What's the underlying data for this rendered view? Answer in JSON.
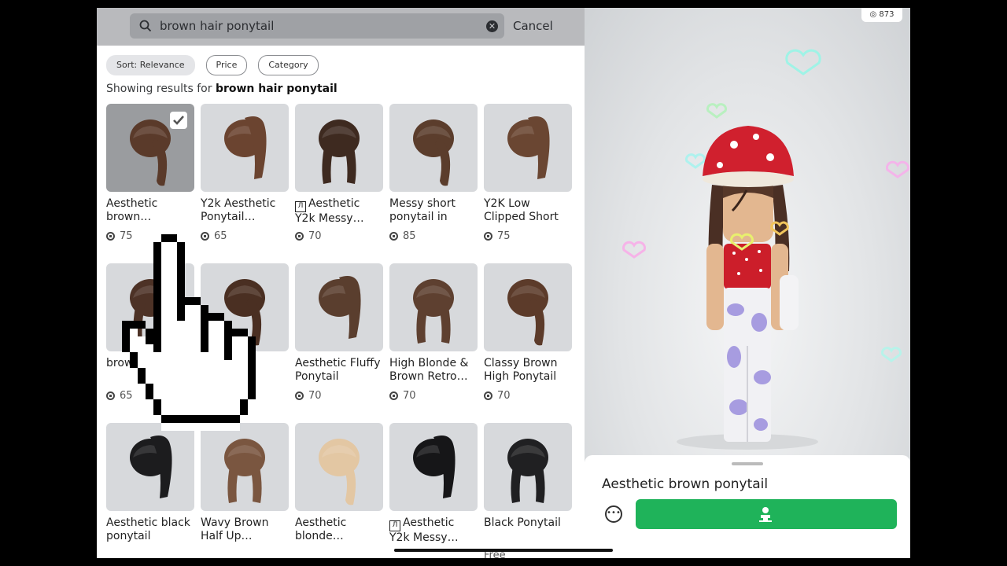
{
  "search": {
    "query": "brown hair ponytail",
    "cancel_label": "Cancel"
  },
  "filters": [
    {
      "label": "Sort: Relevance",
      "active": true
    },
    {
      "label": "Price",
      "active": false
    },
    {
      "label": "Category",
      "active": false
    }
  ],
  "results": {
    "prefix": "Showing results for",
    "query": "brown hair ponytail"
  },
  "items": [
    {
      "name": "Aesthetic brown…",
      "price": "75",
      "selected": true,
      "limited": false,
      "hair": "#5a3a2a"
    },
    {
      "name": "Y2k Aesthetic Ponytail…",
      "price": "65",
      "selected": false,
      "limited": false,
      "hair": "#6b4430"
    },
    {
      "name": "Aesthetic Y2k Messy…",
      "price": "70",
      "selected": false,
      "limited": true,
      "hair": "#3e2a20"
    },
    {
      "name": "Messy short ponytail in",
      "price": "85",
      "selected": false,
      "limited": false,
      "hair": "#5b3d2c"
    },
    {
      "name": "Y2K Low Clipped Short",
      "price": "75",
      "selected": false,
      "limited": false,
      "hair": "#6a4632"
    },
    {
      "name": "brown ponyt…",
      "price": "65",
      "selected": false,
      "limited": false,
      "hair": "#4d3226"
    },
    {
      "name": "",
      "price": "",
      "selected": false,
      "limited": false,
      "hair": "#4a2f22"
    },
    {
      "name": "Aesthetic Fluffy Ponytail",
      "price": "70",
      "selected": false,
      "limited": false,
      "hair": "#5a3e2e"
    },
    {
      "name": "High Blonde & Brown Retro…",
      "price": "70",
      "selected": false,
      "limited": false,
      "hair": "#5e4030"
    },
    {
      "name": "Classy Brown High Ponytail",
      "price": "70",
      "selected": false,
      "limited": false,
      "hair": "#5c3b2a"
    },
    {
      "name": "Aesthetic black ponytail",
      "price": "",
      "selected": false,
      "limited": false,
      "hair": "#1c1c1e"
    },
    {
      "name": "Wavy Brown Half Up…",
      "price": "",
      "selected": false,
      "limited": false,
      "hair": "#7a5640"
    },
    {
      "name": "Aesthetic blonde…",
      "price": "",
      "selected": false,
      "limited": false,
      "hair": "#e3c7a3"
    },
    {
      "name": "Aesthetic Y2k Messy…",
      "price": "",
      "selected": false,
      "limited": true,
      "hair": "#161618"
    },
    {
      "name": "Black Ponytail",
      "price": "Free",
      "selected": false,
      "limited": false,
      "hair": "#202022"
    }
  ],
  "balance": "873",
  "preview": {
    "title": "Aesthetic brown ponytail"
  },
  "colors": {
    "try_on": "#1fb35a",
    "hat": "#d0202e",
    "top": "#cc1e2a",
    "pants": "#a79ce0"
  }
}
